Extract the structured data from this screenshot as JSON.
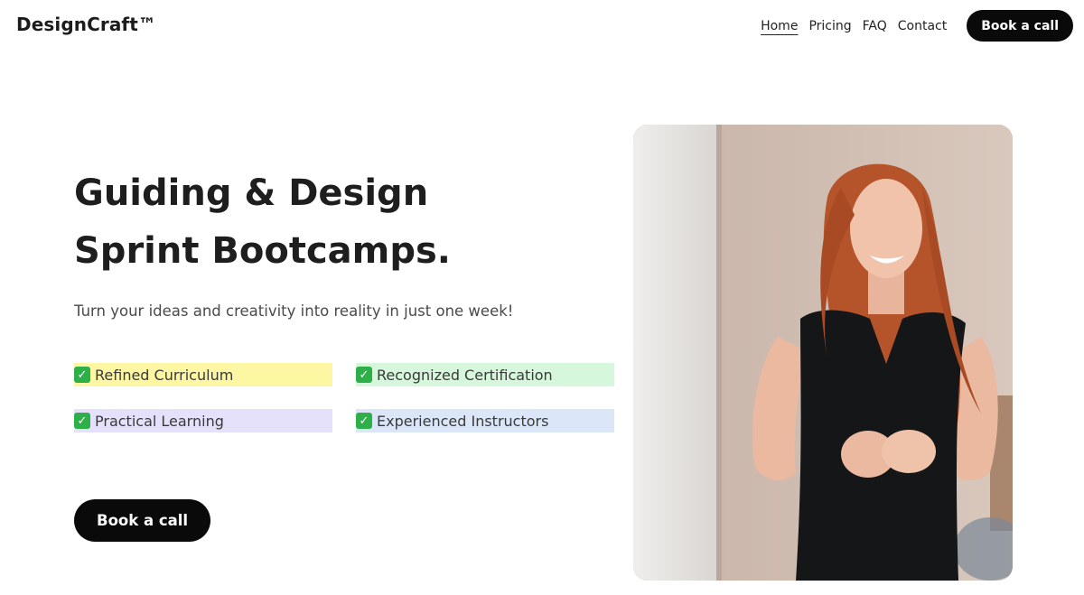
{
  "header": {
    "logo": "DesignCraft™",
    "nav": [
      {
        "label": "Home",
        "active": true
      },
      {
        "label": "Pricing",
        "active": false
      },
      {
        "label": "FAQ",
        "active": false
      },
      {
        "label": "Contact",
        "active": false
      }
    ],
    "cta_label": "Book a call"
  },
  "hero": {
    "title_line1": "Guiding & Design",
    "title_line2": "Sprint Bootcamps.",
    "subtitle": "Turn your ideas and creativity into reality in just one week!",
    "features": [
      {
        "label": "Refined Curriculum",
        "highlight": "#fdf7a4"
      },
      {
        "label": "Recognized Certification",
        "highlight": "#d7f7dc"
      },
      {
        "label": "Practical Learning",
        "highlight": "#e6e1fb"
      },
      {
        "label": "Experienced Instructors",
        "highlight": "#dbe6f9"
      }
    ],
    "check_icon": "check-mark-icon",
    "cta_label": "Book a call"
  },
  "colors": {
    "accent": "#0a0a0a",
    "check": "#2eaf4a"
  }
}
